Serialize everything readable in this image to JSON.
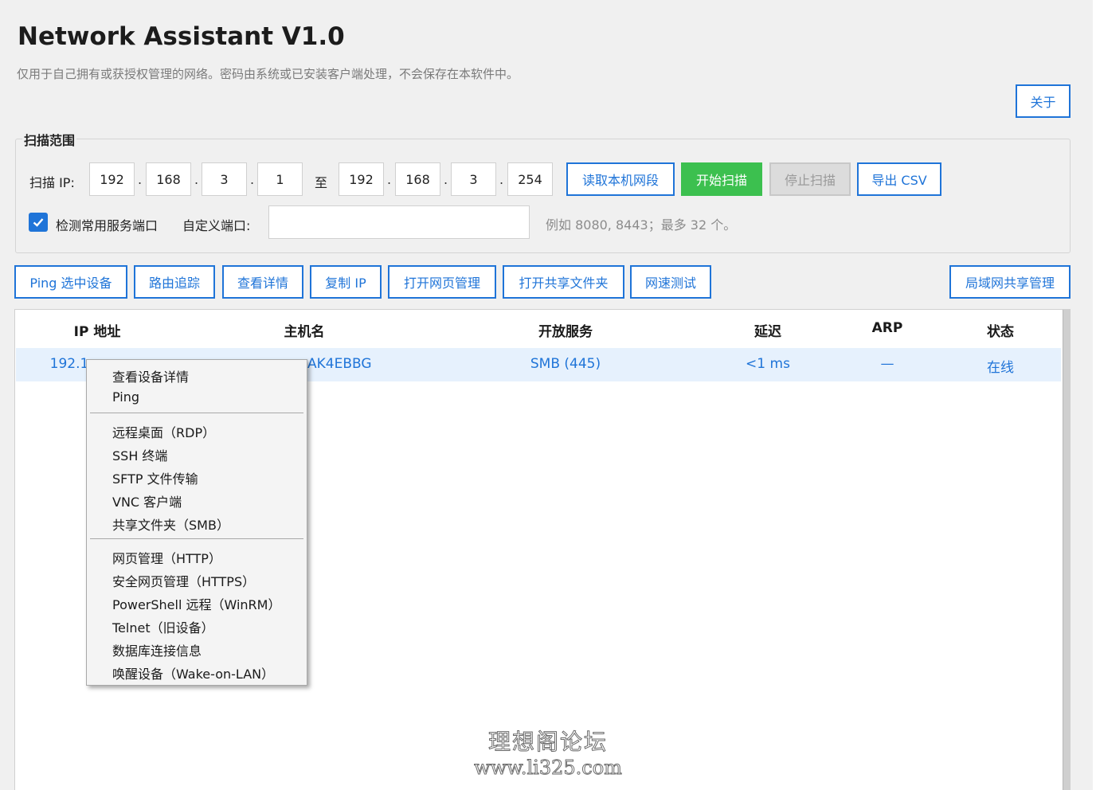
{
  "app": {
    "title": "Network Assistant V1.0",
    "subtitle": "仅用于自己拥有或获授权管理的网络。密码由系统或已安装客户端处理，不会保存在本软件中。",
    "about_label": "关于"
  },
  "scan": {
    "group_title": "扫描范围",
    "ip_label": "扫描 IP:",
    "start_ip": [
      "192",
      "168",
      "3",
      "1"
    ],
    "to_label": "至",
    "end_ip": [
      "192",
      "168",
      "3",
      "254"
    ],
    "dot": ".",
    "read_local_label": "读取本机网段",
    "start_label": "开始扫描",
    "stop_label": "停止扫描",
    "export_label": "导出 CSV",
    "check_ports_label": "检测常用服务端口",
    "check_ports_checked": true,
    "custom_port_label": "自定义端口:",
    "custom_port_value": "",
    "hint": "例如 8080, 8443；最多 32 个。"
  },
  "toolbar": {
    "ping": "Ping 选中设备",
    "trace": "路由追踪",
    "details": "查看详情",
    "copy_ip": "复制 IP",
    "web": "打开网页管理",
    "share": "打开共享文件夹",
    "speed": "网速测试",
    "lan_share": "局域网共享管理"
  },
  "table": {
    "headers": {
      "ip": "IP 地址",
      "host": "主机名",
      "services": "开放服务",
      "latency": "延迟",
      "arp": "ARP",
      "status": "状态"
    },
    "rows": [
      {
        "ip": "192.1",
        "host": "AK4EBBG",
        "services": "SMB (445)",
        "latency": "<1 ms",
        "arp": "—",
        "status": "在线"
      }
    ]
  },
  "context_menu": {
    "details": "查看设备详情",
    "ping": "Ping",
    "rdp": "远程桌面（RDP）",
    "ssh": "SSH 终端",
    "sftp": "SFTP 文件传输",
    "vnc": "VNC 客户端",
    "smb": "共享文件夹（SMB）",
    "http": "网页管理（HTTP）",
    "https": "安全网页管理（HTTPS）",
    "winrm": "PowerShell 远程（WinRM）",
    "telnet": "Telnet（旧设备）",
    "db": "数据库连接信息",
    "wol": "唤醒设备（Wake-on-LAN）"
  },
  "watermark": {
    "line1": "理想阁论坛",
    "line2": "www.li325.com"
  },
  "colors": {
    "accent": "#1f74d8",
    "start_green": "#3cc04f",
    "selected_row": "#e6f1fd"
  }
}
